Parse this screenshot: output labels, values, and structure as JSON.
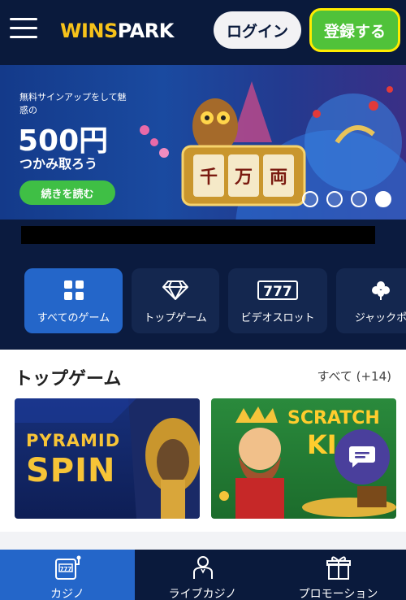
{
  "header": {
    "logo": {
      "part1": "WINS",
      "part2": "PARK"
    },
    "login_label": "ログイン",
    "register_label": "登録する"
  },
  "banner": {
    "subtitle": "無料サインアップをして魅惑の",
    "amount": "500円",
    "headline": "つかみ取ろう",
    "cta_label": "続きを読む",
    "reel_chars": [
      "千",
      "万",
      "両"
    ],
    "carousel": {
      "count": 4,
      "active_index": 3
    }
  },
  "categories": [
    {
      "label": "すべてのゲーム",
      "icon": "grid-icon",
      "glyph": "▦",
      "active": true
    },
    {
      "label": "トップゲーム",
      "icon": "diamond-icon",
      "glyph": "◇",
      "active": false
    },
    {
      "label": "ビデオスロット",
      "icon": "slot-777-icon",
      "glyph": "777",
      "active": false
    },
    {
      "label": "ジャックポ",
      "icon": "clover-icon",
      "glyph": "✤",
      "active": false
    }
  ],
  "section": {
    "title": "トップゲーム",
    "all_label": "すべて (+14)"
  },
  "games": [
    {
      "line1": "PYRAMID",
      "line2": "SPIN"
    },
    {
      "line1": "SCRATCH",
      "line2": "KI"
    }
  ],
  "bottom_nav": [
    {
      "label": "カジノ",
      "icon": "slot-machine-icon",
      "active": true
    },
    {
      "label": "ライブカジノ",
      "icon": "live-dealer-icon",
      "active": false
    },
    {
      "label": "プロモーション",
      "icon": "gift-icon",
      "active": false
    }
  ],
  "colors": {
    "header_bg": "#0a1a3c",
    "accent_blue": "#2466c9",
    "register_green": "#50c23a",
    "register_border": "#ffec00"
  }
}
